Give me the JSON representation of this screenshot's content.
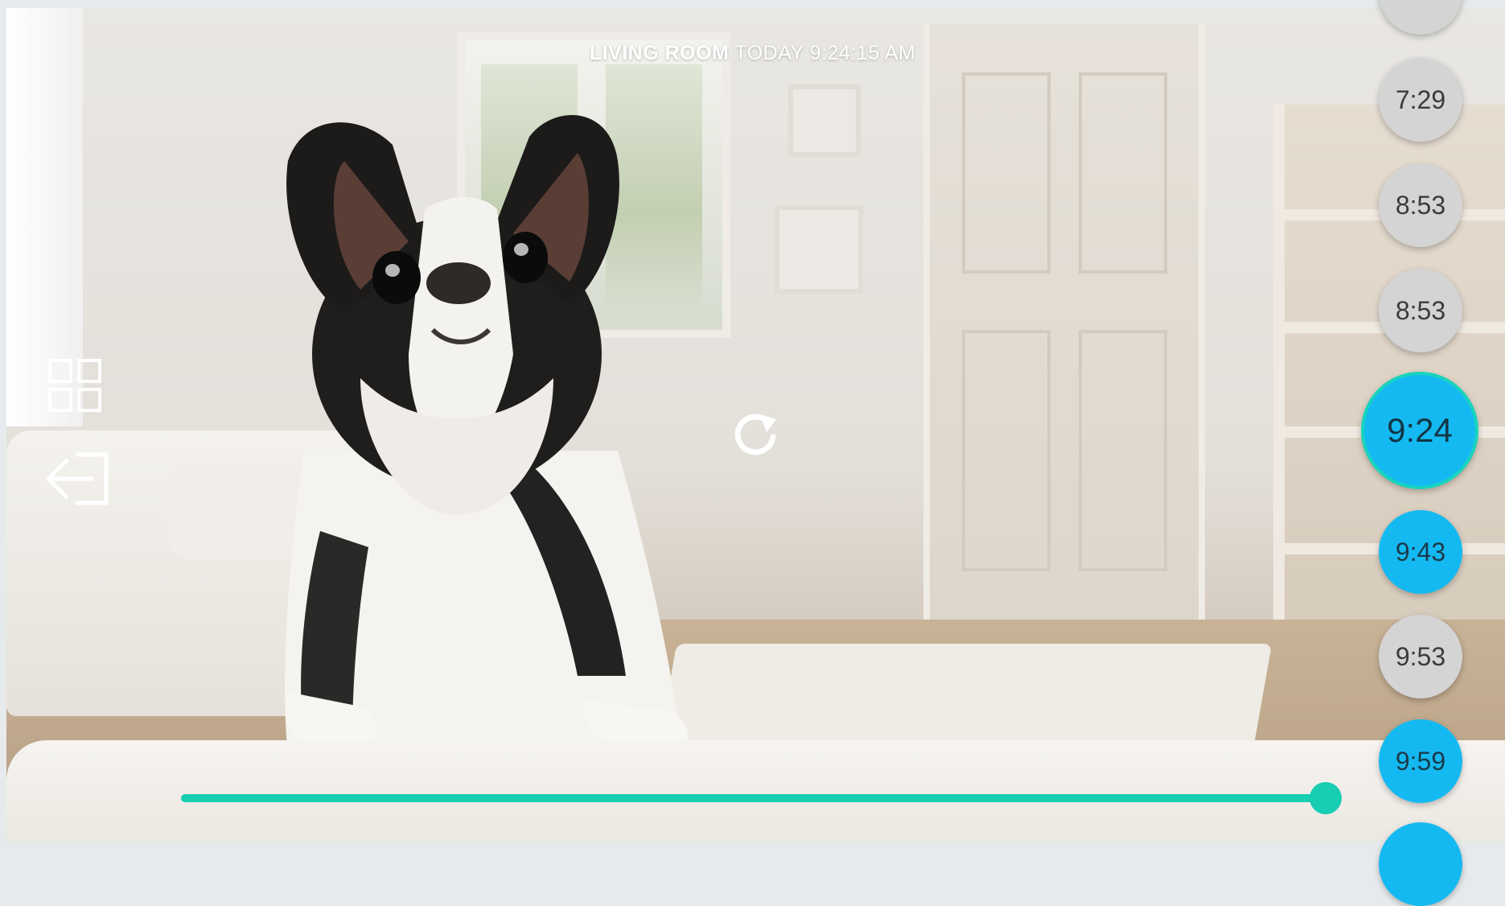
{
  "header": {
    "room": "LIVING ROOM",
    "datetime": "TODAY 9:24:15 AM"
  },
  "icons": {
    "grid": "grid-view-icon",
    "exit": "exit-arrow-icon",
    "refresh": "refresh-icon"
  },
  "timeline": {
    "events": [
      {
        "label": "",
        "state": "grey"
      },
      {
        "label": "7:29",
        "state": "grey"
      },
      {
        "label": "8:53",
        "state": "grey"
      },
      {
        "label": "8:53",
        "state": "grey"
      },
      {
        "label": "9:24",
        "state": "active"
      },
      {
        "label": "9:43",
        "state": "blue"
      },
      {
        "label": "9:53",
        "state": "grey"
      },
      {
        "label": "9:59",
        "state": "blue"
      },
      {
        "label": "",
        "state": "blue"
      }
    ]
  },
  "playback": {
    "progress": 0.995
  },
  "colors": {
    "accent_teal": "#17cdb2",
    "event_blue": "#15b9f2",
    "event_grey": "#d4d4d4"
  }
}
